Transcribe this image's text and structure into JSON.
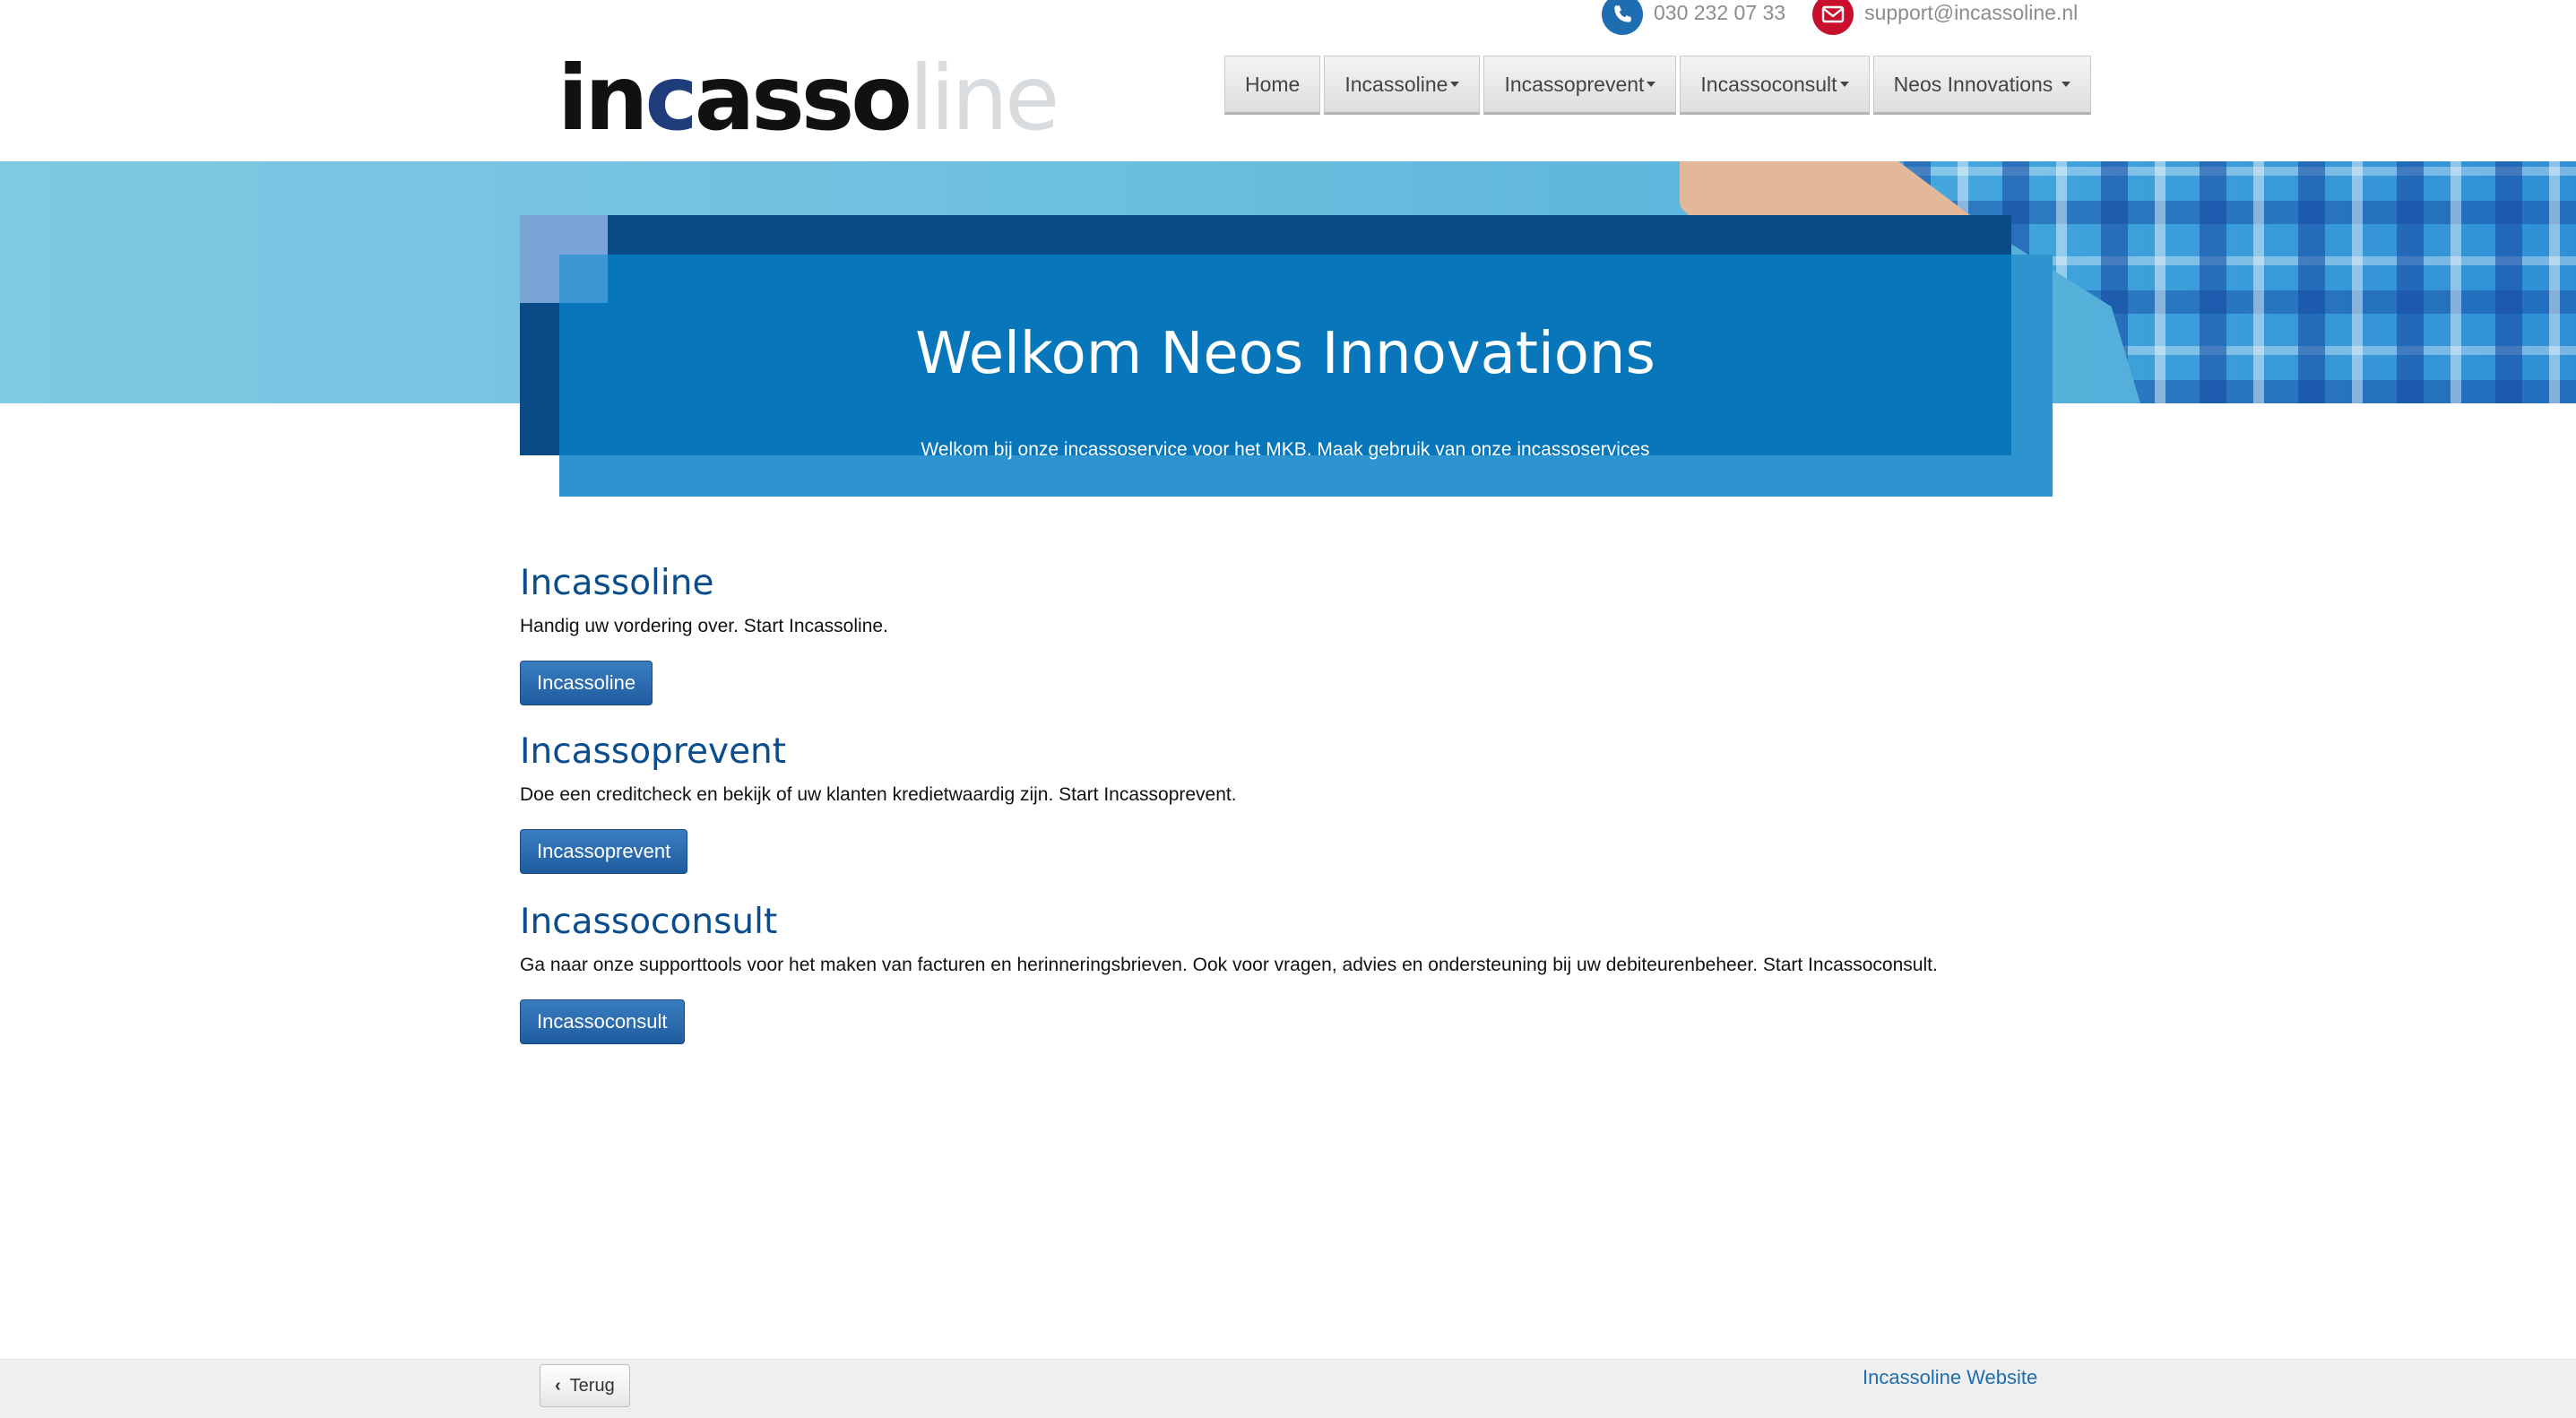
{
  "contact": {
    "phone": "030 232 07 33",
    "email": "support@incassoline.nl",
    "phone_icon": "phone-icon",
    "mail_icon": "envelope-icon"
  },
  "logo": {
    "part1": "in",
    "part2": "c",
    "part3": "asso",
    "part4": "line"
  },
  "nav": {
    "home": "Home",
    "incassoline": "Incassoline",
    "incassoprevent": "Incassoprevent",
    "incassoconsult": "Incassoconsult",
    "neos": "Neos Innovations"
  },
  "hero": {
    "title": "Welkom Neos Innovations",
    "subtitle": "Welkom bij onze incassoservice voor het MKB. Maak gebruik van onze incassoservices"
  },
  "sections": [
    {
      "title": "Incassoline",
      "text": "Handig uw vordering over. Start Incassoline.",
      "button": "Incassoline"
    },
    {
      "title": "Incassoprevent",
      "text": "Doe een creditcheck en bekijk of uw klanten kredietwaardig zijn. Start Incassoprevent.",
      "button": "Incassoprevent"
    },
    {
      "title": "Incassoconsult",
      "text": "Ga naar onze supporttools voor het maken van facturen en herinneringsbrieven. Ook voor vragen, advies en ondersteuning bij uw debiteurenbeheer. Start Incassoconsult.",
      "button": "Incassoconsult"
    }
  ],
  "footer": {
    "back": "Terug",
    "website": "Incassoline Website"
  },
  "colors": {
    "brand_dark": "#0a4a86",
    "brand_mid": "#0876bb",
    "brand_light": "#2e94cf",
    "accent_red": "#c8102e"
  }
}
